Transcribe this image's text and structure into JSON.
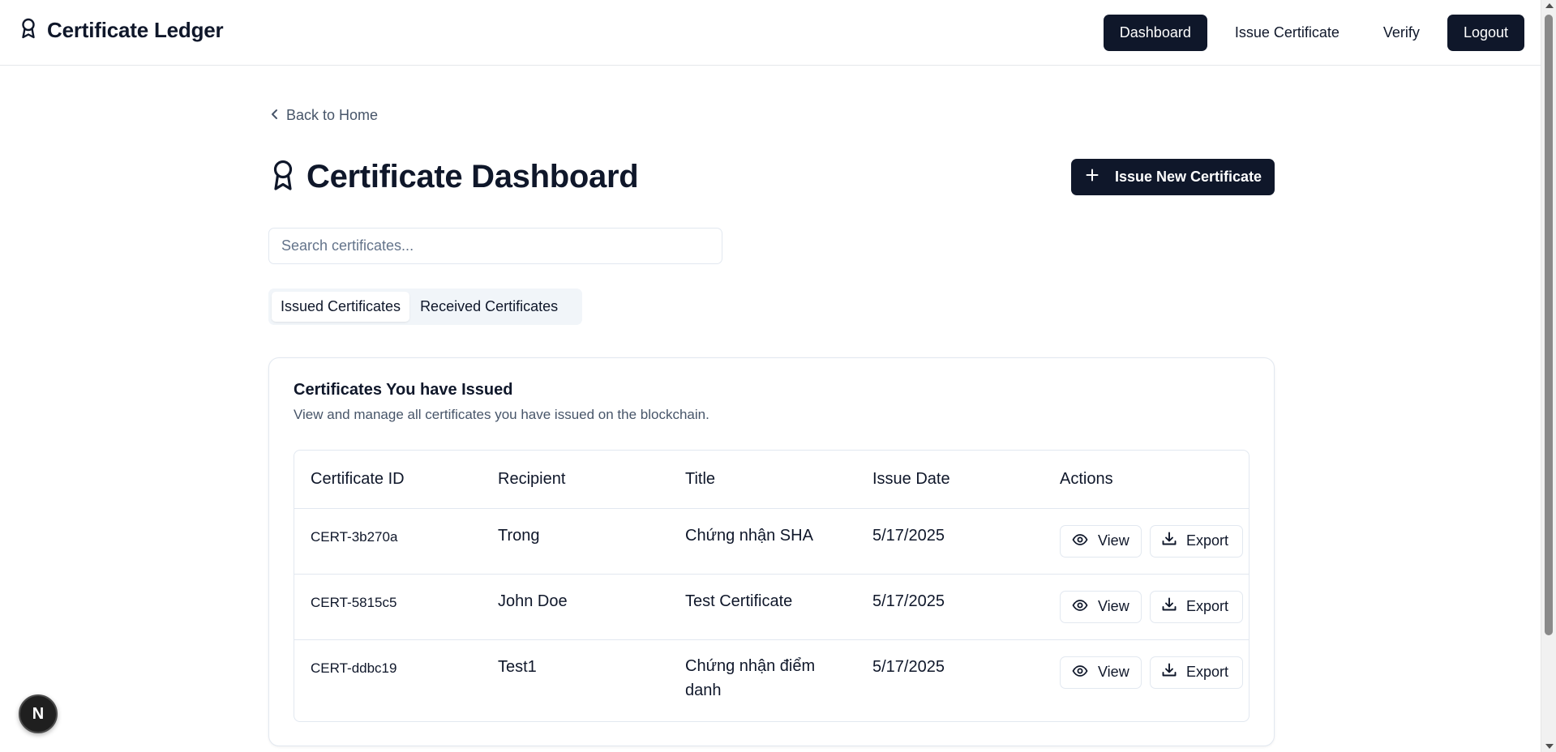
{
  "header": {
    "brand": "Certificate Ledger",
    "brand_icon": "award-icon",
    "nav": {
      "dashboard": "Dashboard",
      "issue": "Issue Certificate",
      "verify": "Verify",
      "logout": "Logout"
    }
  },
  "back_link": "Back to Home",
  "page": {
    "title": "Certificate Dashboard",
    "issue_new": "Issue New Certificate"
  },
  "search": {
    "placeholder": "Search certificates..."
  },
  "tabs": {
    "issued": "Issued Certificates",
    "received": "Received Certificates"
  },
  "card": {
    "title": "Certificates You have Issued",
    "description": "View and manage all certificates you have issued on the blockchain."
  },
  "table": {
    "headers": {
      "id": "Certificate ID",
      "recipient": "Recipient",
      "title": "Title",
      "date": "Issue Date",
      "actions": "Actions"
    },
    "rows": [
      {
        "id": "CERT-3b270a",
        "recipient": "Trong",
        "title": "Chứng nhận SHA",
        "date": "5/17/2025"
      },
      {
        "id": "CERT-5815c5",
        "recipient": "John Doe",
        "title": "Test Certificate",
        "date": "5/17/2025"
      },
      {
        "id": "CERT-ddbc19",
        "recipient": "Test1",
        "title": "Chứng nhận điểm danh",
        "date": "5/17/2025"
      }
    ],
    "view_label": "View",
    "export_label": "Export"
  },
  "dev_badge": "N",
  "colors": {
    "primary": "#0f172a",
    "muted": "#475569",
    "border": "#e2e8f0"
  }
}
